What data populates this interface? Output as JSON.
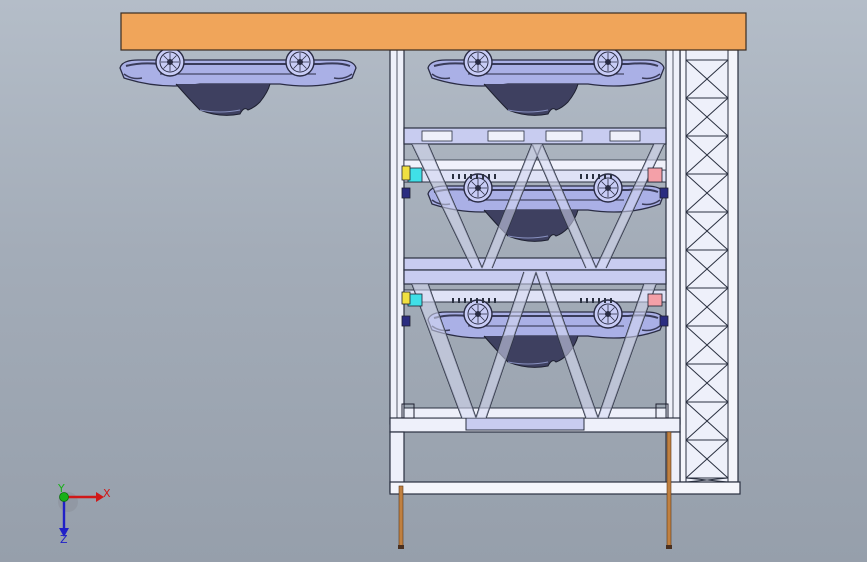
{
  "triad": {
    "x_label": "X",
    "y_label": "Y",
    "z_label": "Z",
    "x_color": "#d01818",
    "y_color": "#18b018",
    "z_color": "#2020c8"
  },
  "colors": {
    "background_top": "#b4bdc8",
    "background_bottom": "#969fab",
    "beam": "#f0a55a",
    "frame": "#eef0fa",
    "frame_line": "#2a3040",
    "platform": "#c8ccf0",
    "car_body": "#aab0e6",
    "car_dark": "#3a3c5a",
    "wheel": "#c8ccf6",
    "pole": "#c08040"
  },
  "cars": [
    {
      "name": "car-top-left"
    },
    {
      "name": "car-top-right"
    },
    {
      "name": "car-level-2"
    },
    {
      "name": "car-level-3"
    }
  ]
}
